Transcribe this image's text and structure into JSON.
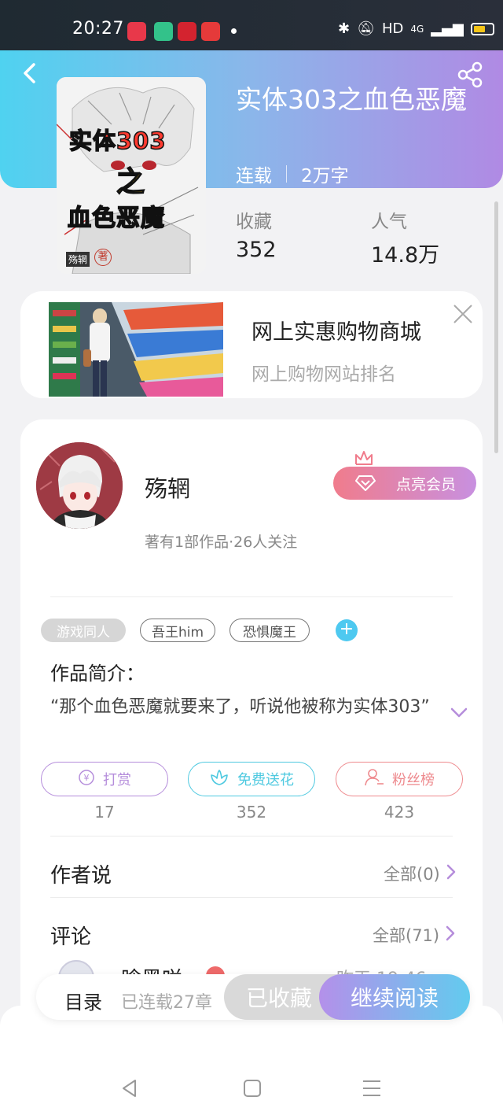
{
  "status": {
    "time": "20:27",
    "hd": "HD",
    "network": "4G"
  },
  "book": {
    "title": "实体303之血色恶魔",
    "status": "连载",
    "word_count": "2万字",
    "cover_text_line1": "实体303",
    "cover_text_line2": "之",
    "cover_text_line3": "血色恶魔",
    "cover_author": "殇辋",
    "cover_seal": "著"
  },
  "stats": {
    "favorites_label": "收藏",
    "favorites_value": "352",
    "popularity_label": "人气",
    "popularity_value": "14.8万"
  },
  "ad": {
    "title": "网上实惠购物商城",
    "subtitle": "网上购物网站排名"
  },
  "author": {
    "name": "殇辋",
    "info": "著有1部作品·26人关注",
    "vip_label": "点亮会员"
  },
  "tags": [
    "游戏同人",
    "吾王him",
    "恐惧魔王"
  ],
  "intro": {
    "title": "作品简介：",
    "text": "“那个血色恶魔就要来了，听说他被称为实体303”"
  },
  "actions": [
    {
      "label": "打赏",
      "count": "17",
      "color": "#b58ddb"
    },
    {
      "label": "免费送花",
      "count": "352",
      "color": "#4ec9e0"
    },
    {
      "label": "粉丝榜",
      "count": "423",
      "color": "#ee8a8e"
    }
  ],
  "author_says": {
    "title": "作者说",
    "link": "全部(0)"
  },
  "comments": {
    "title": "评论",
    "link": "全部(71)",
    "first_user": "晗黑咲",
    "first_time": "昨天 19:46"
  },
  "bottom": {
    "toc_label": "目录",
    "toc_sub": "已连载27章",
    "fav_label": "已收藏",
    "read_label": "继续阅读"
  }
}
